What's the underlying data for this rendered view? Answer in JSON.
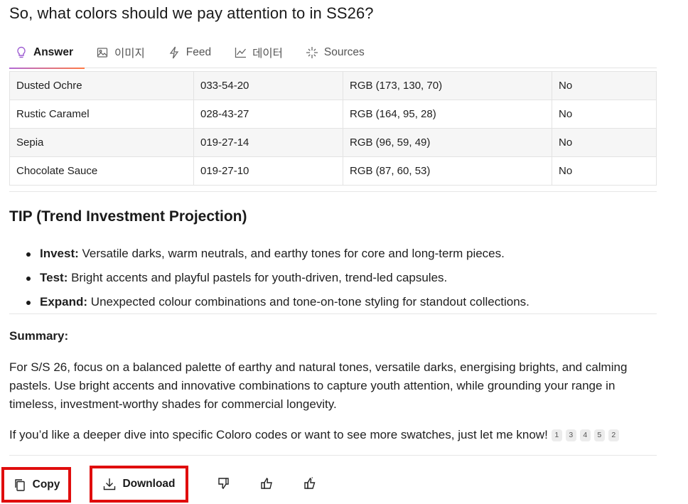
{
  "question": "So, what colors should we pay attention to in SS26?",
  "tabs": [
    {
      "label": "Answer",
      "icon": "lightbulb-icon",
      "active": true
    },
    {
      "label": "이미지",
      "icon": "image-icon"
    },
    {
      "label": "Feed",
      "icon": "lightning-icon"
    },
    {
      "label": "데이터",
      "icon": "line-chart-icon"
    },
    {
      "label": "Sources",
      "icon": "sparkle-icon"
    }
  ],
  "table": {
    "rows": [
      {
        "name": "Dusted Ochre",
        "code": "033-54-20",
        "rgb": "RGB (173, 130, 70)",
        "flag": "No"
      },
      {
        "name": "Rustic Caramel",
        "code": "028-43-27",
        "rgb": "RGB (164, 95, 28)",
        "flag": "No"
      },
      {
        "name": "Sepia",
        "code": "019-27-14",
        "rgb": "RGB (96, 59, 49)",
        "flag": "No"
      },
      {
        "name": "Chocolate Sauce",
        "code": "019-27-10",
        "rgb": "RGB (87, 60, 53)",
        "flag": "No"
      }
    ]
  },
  "tip": {
    "title": "TIP (Trend Investment Projection)",
    "items": [
      {
        "label": "Invest:",
        "text": " Versatile darks, warm neutrals, and earthy tones for core and long-term pieces."
      },
      {
        "label": "Test:",
        "text": " Bright accents and playful pastels for youth-driven, trend-led capsules."
      },
      {
        "label": "Expand:",
        "text": " Unexpected colour combinations and tone-on-tone styling for standout collections."
      }
    ]
  },
  "summary": {
    "heading": "Summary:",
    "paragraph": "For S/S 26, focus on a balanced palette of earthy and natural tones, versatile darks, energising brights, and calming pastels. Use bright accents and innovative combinations to capture youth attention, while grounding your range in timeless, investment-worthy shades for commercial longevity.",
    "closing": "If you’d like a deeper dive into specific Coloro codes or want to see more swatches, just let me know!",
    "citations": [
      "1",
      "3",
      "4",
      "5",
      "2"
    ]
  },
  "actions": {
    "copy_label": "Copy",
    "download_label": "Download"
  },
  "colors": {
    "accent_gradient_start": "#b26ad6",
    "accent_gradient_end": "#ff7a45",
    "highlight_border": "#e00d0d"
  }
}
